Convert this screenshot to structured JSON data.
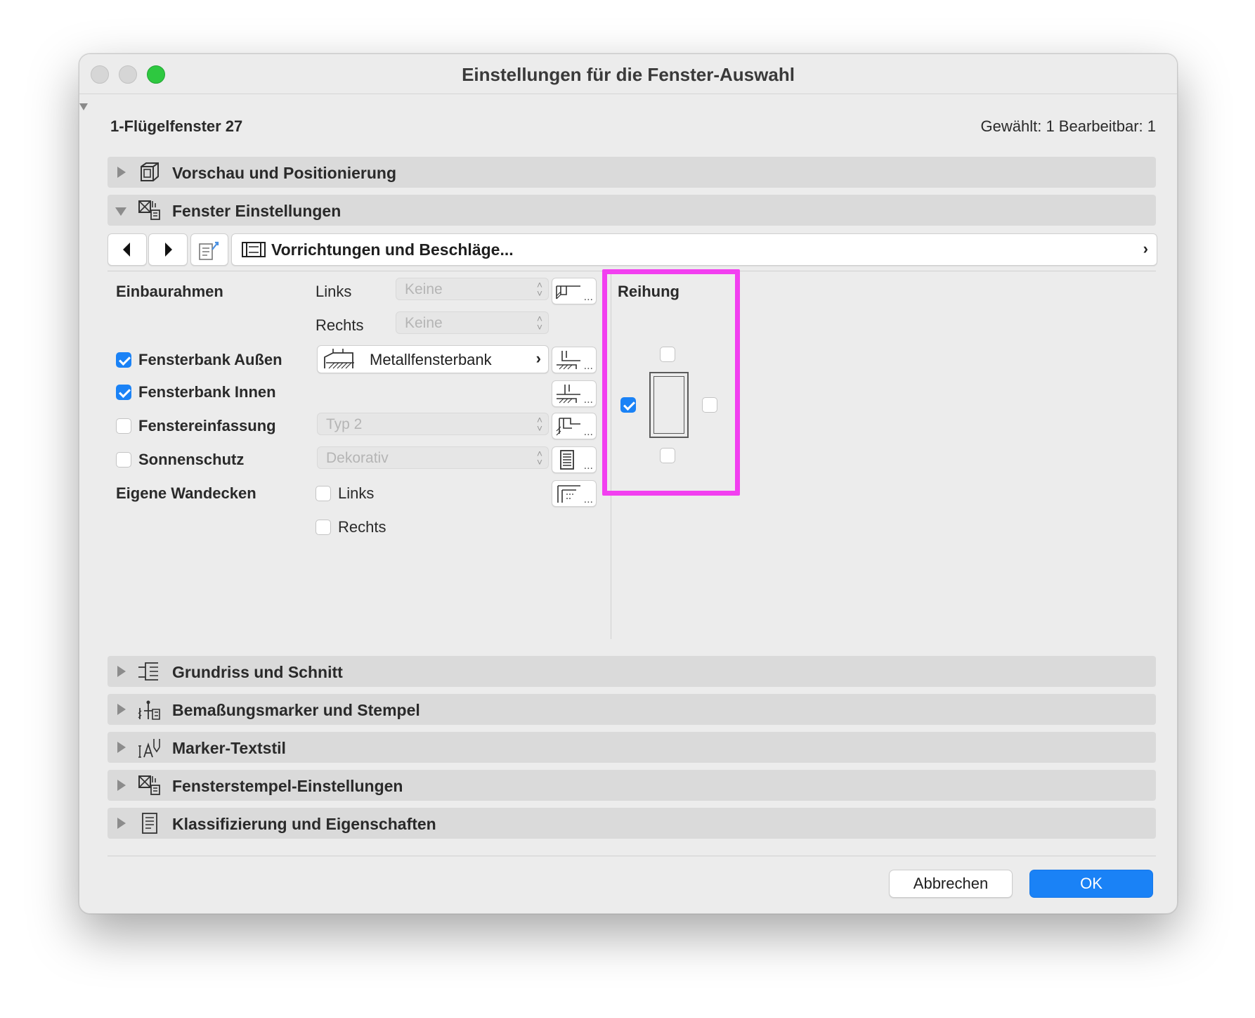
{
  "window": {
    "title": "Einstellungen für die Fenster-Auswahl"
  },
  "header": {
    "name": "1-Flügelfenster 27",
    "count": "Gewählt: 1 Bearbeitbar: 1"
  },
  "sections": {
    "preview": "Vorschau und Positionierung",
    "window_settings": "Fenster Einstellungen",
    "floorplan": "Grundriss und Schnitt",
    "dimension": "Bemaßungsmarker und Stempel",
    "marker_text": "Marker-Textstil",
    "stamp": "Fensterstempel-Einstellungen",
    "classification": "Klassifizierung und Eigenschaften"
  },
  "toolbar": {
    "path_label": "Vorrichtungen und Beschläge..."
  },
  "form": {
    "einbaurahmen": "Einbaurahmen",
    "links": "Links",
    "rechts": "Rechts",
    "keine_links": "Keine",
    "keine_rechts": "Keine",
    "fensterbank_aussen": "Fensterbank Außen",
    "fensterbank_aussen_checked": true,
    "metallfensterbank": "Metallfensterbank",
    "fensterbank_innen": "Fensterbank Innen",
    "fensterbank_innen_checked": true,
    "fenstereinfassung": "Fenstereinfassung",
    "fenstereinfassung_checked": false,
    "typ2": "Typ 2",
    "sonnenschutz": "Sonnenschutz",
    "sonnenschutz_checked": false,
    "dekorativ": "Dekorativ",
    "eigene_wandecken": "Eigene Wandecken",
    "wand_links": "Links",
    "wand_links_checked": false,
    "wand_rechts": "Rechts",
    "wand_rechts_checked": false,
    "dots": "..."
  },
  "reihung": {
    "label": "Reihung",
    "top_checked": false,
    "left_checked": true,
    "right_checked": false,
    "bottom_checked": false
  },
  "footer": {
    "cancel": "Abbrechen",
    "ok": "OK"
  },
  "colors": {
    "accent": "#1a82f6",
    "highlight": "#f23ff0",
    "close_light": "#d6d6d6",
    "maximize_light": "#2ec840"
  }
}
